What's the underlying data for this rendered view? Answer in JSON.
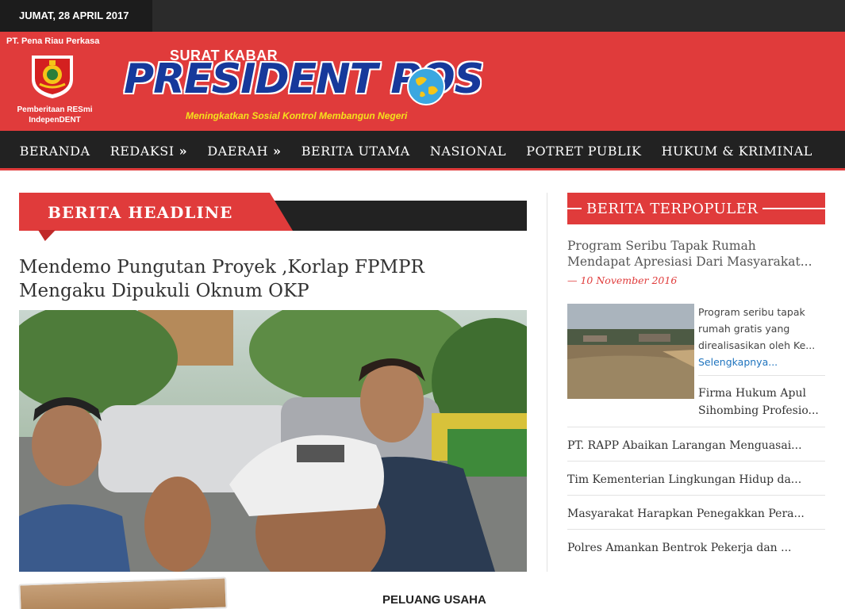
{
  "topbar": {
    "date": "JUMAT, 28 APRIL 2017"
  },
  "header": {
    "company": "PT. Pena Riau Perkasa",
    "tagline_left_1": "Pemberitaan  RESmi",
    "tagline_left_2": "IndepenDENT",
    "surat_kabar": "SURAT KABAR",
    "title": "PRESIDENT POS",
    "tagline": "Meningkatkan Sosial Kontrol Membangun Negeri",
    "colors": {
      "red": "#e03b3b",
      "blue": "#16399b",
      "yellow": "#f5e21c"
    }
  },
  "nav": {
    "items": [
      {
        "label": "BERANDA",
        "arrow": ""
      },
      {
        "label": "REDAKSI",
        "arrow": " »"
      },
      {
        "label": "DAERAH",
        "arrow": " »"
      },
      {
        "label": "BERITA UTAMA",
        "arrow": ""
      },
      {
        "label": "NASIONAL",
        "arrow": ""
      },
      {
        "label": "POTRET PUBLIK",
        "arrow": ""
      },
      {
        "label": "HUKUM & KRIMINAL",
        "arrow": ""
      }
    ]
  },
  "main": {
    "section_label": "BERITA HEADLINE",
    "headline_line1": "Mendemo Pungutan Proyek ,Korlap FPMPR",
    "headline_line2": "Mengaku Dipukuli Oknum OKP",
    "ad_title": "PELUANG USAHA"
  },
  "sidebar": {
    "section_label": "BERITA TERPOPULER",
    "featured": {
      "title_line1": "Program Seribu Tapak Rumah",
      "title_line2": "Mendapat Apresiasi Dari Masyarakat...",
      "date": "— 10 November 2016",
      "excerpt_line1": "Program seribu tapak",
      "excerpt_line2": "rumah gratis yang",
      "excerpt_line3": "direalisasikan oleh Ke...",
      "more": "Selengkapnya...",
      "second_line1": "Firma Hukum Apul",
      "second_line2": "Sihombing Profesio..."
    },
    "list": [
      "PT. RAPP Abaikan Larangan Menguasai...",
      "Tim Kementerian Lingkungan Hidup da...",
      "Masyarakat Harapkan Penegakkan Pera...",
      "Polres Amankan Bentrok Pekerja dan ..."
    ]
  }
}
